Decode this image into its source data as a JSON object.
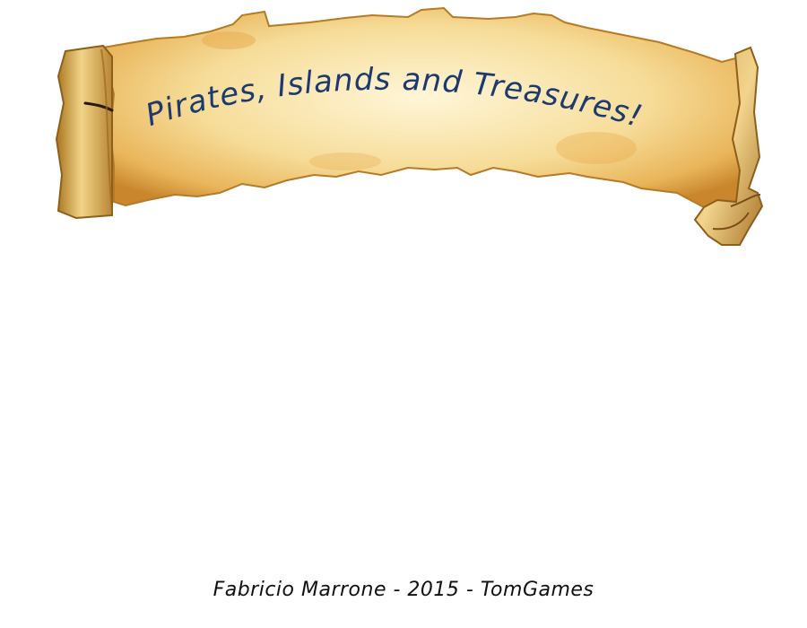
{
  "screen": {
    "background": "#ffffff"
  },
  "title_banner": {
    "text": "Pirates, Islands and Treasures!",
    "text_color": "#1d3a6e",
    "parchment_color": "#f3d58f",
    "parchment_edge_color": "#c98a2e"
  },
  "credits": {
    "text": "Fabricio Marrone - 2015 - TomGames"
  }
}
